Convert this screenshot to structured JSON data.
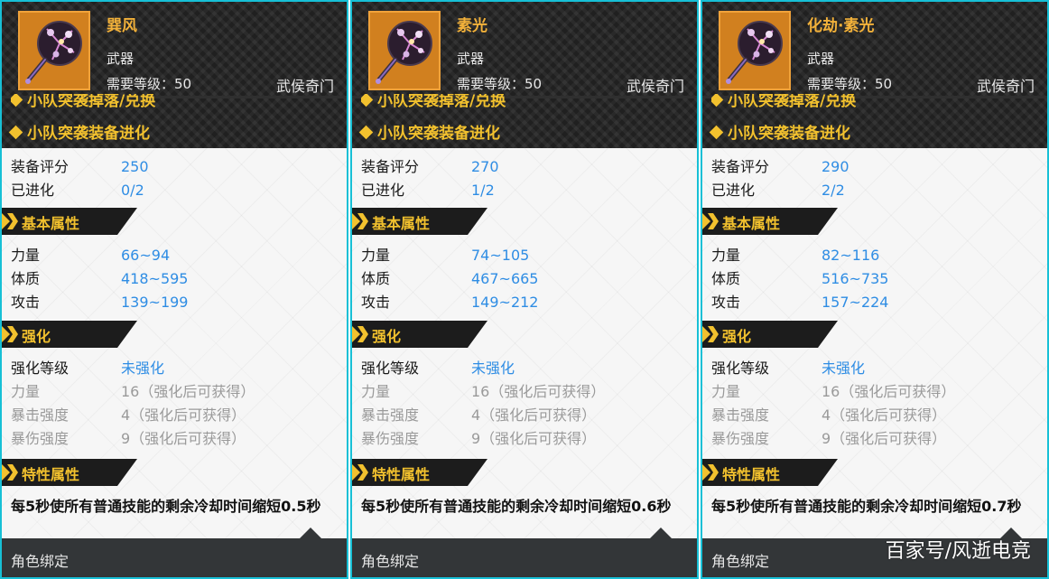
{
  "panels": [
    {
      "name": "巽风",
      "type": "武器",
      "requirement": "需要等级：50",
      "class": "武侯奇门",
      "sources": [
        "小队突袭掉落/兑换",
        "小队突袭装备进化"
      ],
      "score_label": "装备评分",
      "score": "250",
      "evolved_label": "已进化",
      "evolved": "0/2",
      "section_basic": "基本属性",
      "stats": [
        {
          "label": "力量",
          "value": "66~94"
        },
        {
          "label": "体质",
          "value": "418~595"
        },
        {
          "label": "攻击",
          "value": "139~199"
        }
      ],
      "section_enhance": "强化",
      "enhance_level_label": "强化等级",
      "enhance_level": "未强化",
      "enhance_stats": [
        {
          "label": "力量",
          "value": "16（强化后可获得）"
        },
        {
          "label": "暴击强度",
          "value": "4（强化后可获得）"
        },
        {
          "label": "暴伤强度",
          "value": "9（强化后可获得）"
        }
      ],
      "section_trait": "特性属性",
      "trait": "每5秒使所有普通技能的剩余冷却时间缩短0.5秒",
      "bind": "角色绑定"
    },
    {
      "name": "素光",
      "type": "武器",
      "requirement": "需要等级：50",
      "class": "武侯奇门",
      "sources": [
        "小队突袭掉落/兑换",
        "小队突袭装备进化"
      ],
      "score_label": "装备评分",
      "score": "270",
      "evolved_label": "已进化",
      "evolved": "1/2",
      "section_basic": "基本属性",
      "stats": [
        {
          "label": "力量",
          "value": "74~105"
        },
        {
          "label": "体质",
          "value": "467~665"
        },
        {
          "label": "攻击",
          "value": "149~212"
        }
      ],
      "section_enhance": "强化",
      "enhance_level_label": "强化等级",
      "enhance_level": "未强化",
      "enhance_stats": [
        {
          "label": "力量",
          "value": "16（强化后可获得）"
        },
        {
          "label": "暴击强度",
          "value": "4（强化后可获得）"
        },
        {
          "label": "暴伤强度",
          "value": "9（强化后可获得）"
        }
      ],
      "section_trait": "特性属性",
      "trait": "每5秒使所有普通技能的剩余冷却时间缩短0.6秒",
      "bind": "角色绑定"
    },
    {
      "name": "化劫·素光",
      "type": "武器",
      "requirement": "需要等级：50",
      "class": "武侯奇门",
      "sources": [
        "小队突袭掉落/兑换",
        "小队突袭装备进化"
      ],
      "score_label": "装备评分",
      "score": "290",
      "evolved_label": "已进化",
      "evolved": "2/2",
      "section_basic": "基本属性",
      "stats": [
        {
          "label": "力量",
          "value": "82~116"
        },
        {
          "label": "体质",
          "value": "516~735"
        },
        {
          "label": "攻击",
          "value": "157~224"
        }
      ],
      "section_enhance": "强化",
      "enhance_level_label": "强化等级",
      "enhance_level": "未强化",
      "enhance_stats": [
        {
          "label": "力量",
          "value": "16（强化后可获得）"
        },
        {
          "label": "暴击强度",
          "value": "4（强化后可获得）"
        },
        {
          "label": "暴伤强度",
          "value": "9（强化后可获得）"
        }
      ],
      "section_trait": "特性属性",
      "trait": "每5秒使所有普通技能的剩余冷却时间缩短0.7秒",
      "bind": "角色绑定"
    }
  ],
  "watermark": "百家号/风逝电竞",
  "icons": {
    "item": "fan-weapon-icon",
    "source": "diamond-bullet-icon",
    "section": "chevron-section-icon",
    "footer": "notch-arrow-icon"
  },
  "colors": {
    "border": "#17c0d6",
    "accent_gold": "#f2c12e",
    "value_blue": "#2f8de4",
    "dim_gray": "#9a9a9a",
    "header_dark": "#202020",
    "footer_dark": "#333638"
  }
}
